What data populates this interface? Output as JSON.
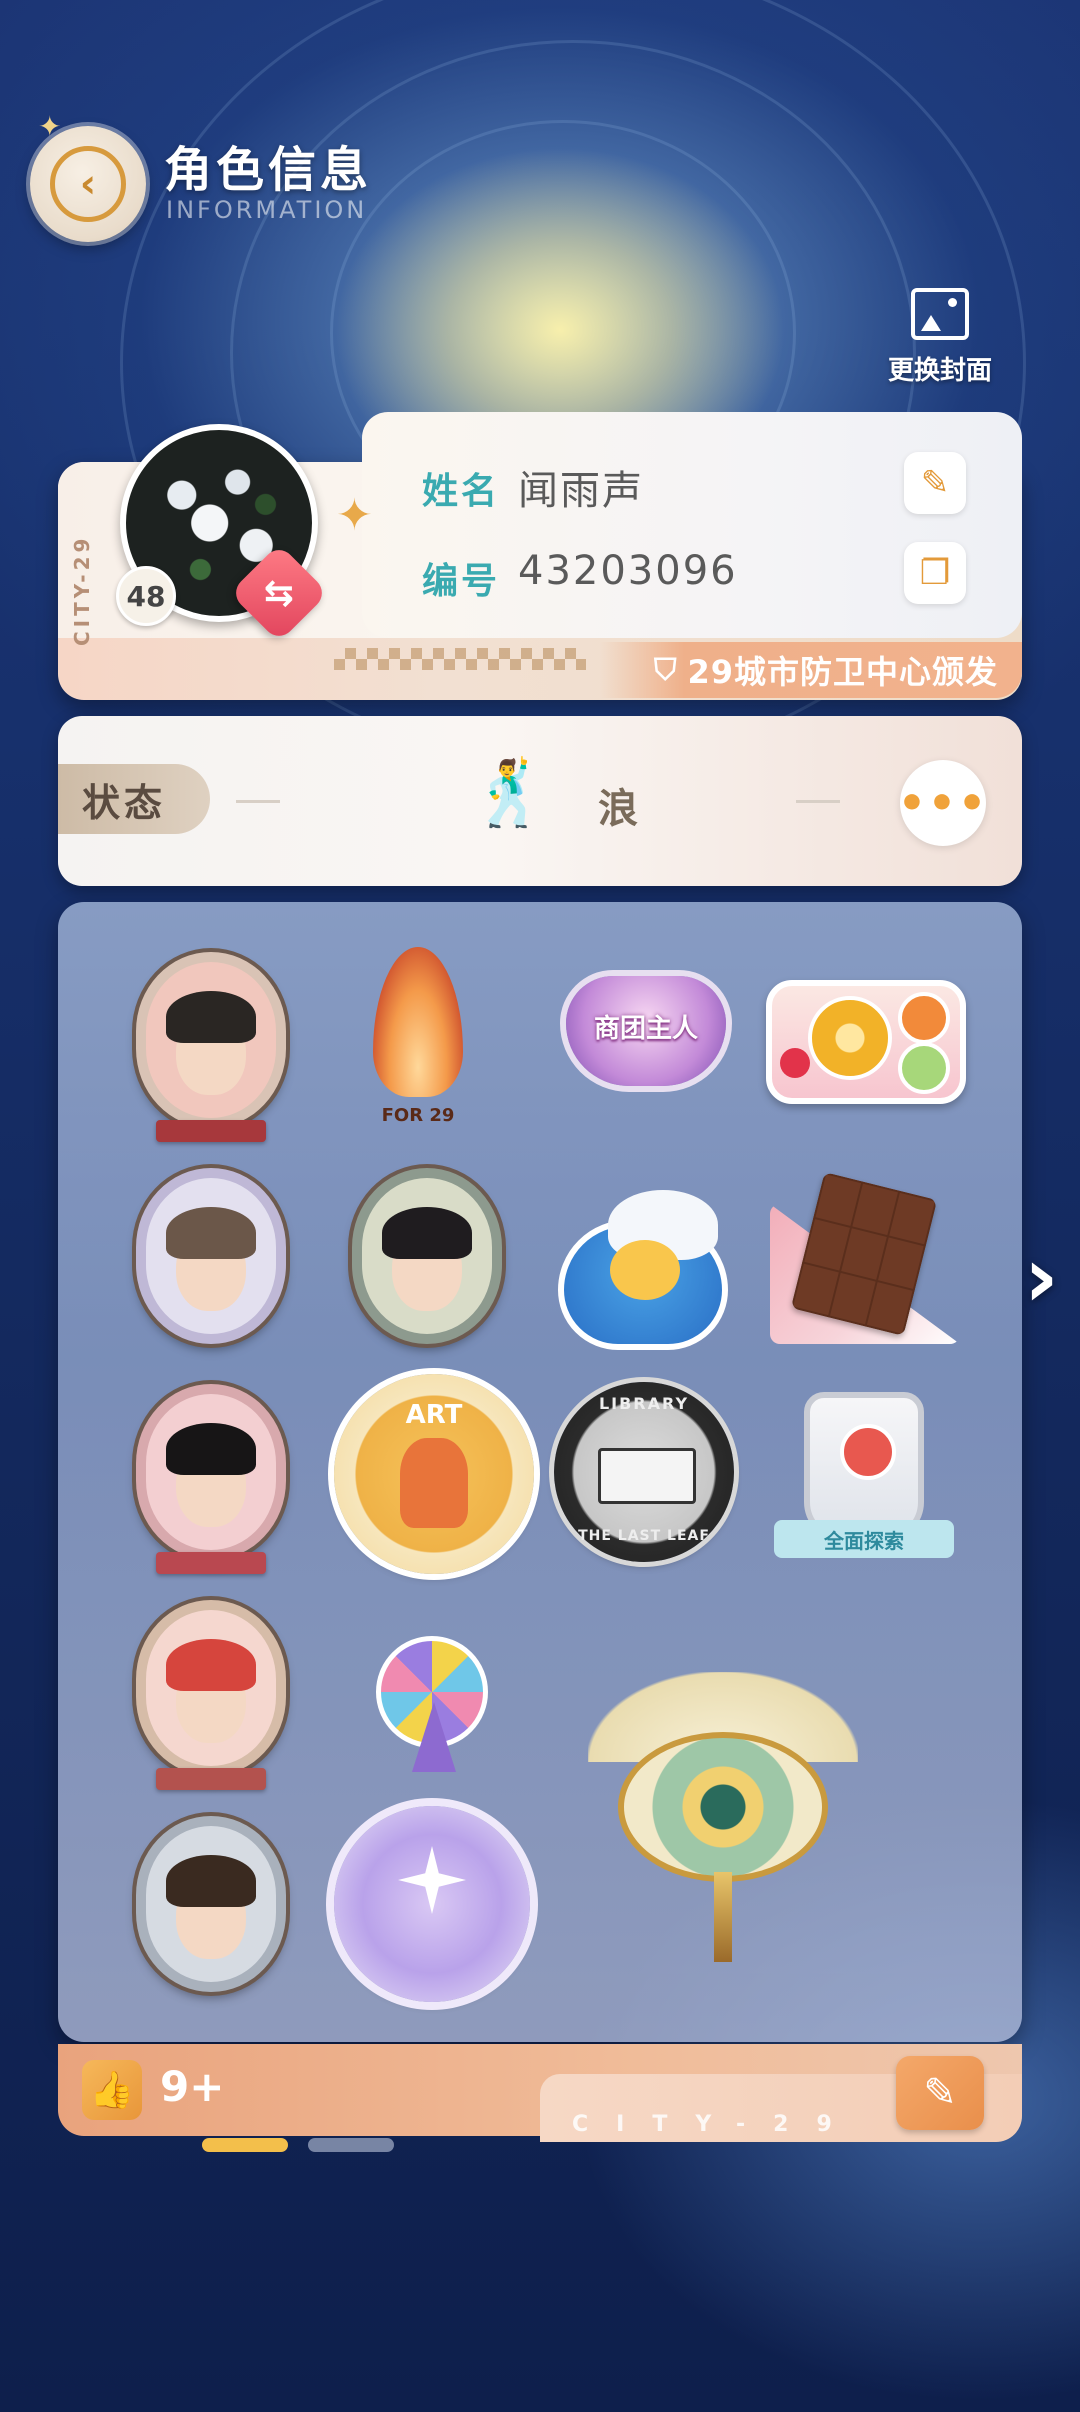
{
  "header": {
    "title": "角色信息",
    "subtitle": "INFORMATION",
    "back_icon": "chevron-left-icon",
    "change_cover_label": "更换封面",
    "change_cover_icon": "image-icon"
  },
  "profile": {
    "card_side_text": "CITY-29",
    "avatar_icon": "white-roses-avatar",
    "level": "48",
    "swap_icon": "swap-icon",
    "name_label": "姓名",
    "name_value": "闻雨声",
    "id_label": "编号",
    "id_value": "43203096",
    "edit_icon": "edit-icon",
    "copy_icon": "copy-icon",
    "issuer_text": "29城市防卫中心颁发",
    "issuer_icon": "shield-icon"
  },
  "status": {
    "label": "状态",
    "value": "浪",
    "figure_icon": "dancing-figure-icon",
    "more_icon": "more-icon"
  },
  "badges": [
    {
      "name": "portrait-badge-dark-haired-man",
      "type": "portrait"
    },
    {
      "name": "flame-badge",
      "type": "flame",
      "text": "FOR 29"
    },
    {
      "name": "guild-owner-heart-badge",
      "type": "heart",
      "text": "商团主人"
    },
    {
      "name": "fruit-badge",
      "type": "fruit"
    },
    {
      "name": "portrait-badge-glasses-woman",
      "type": "portrait"
    },
    {
      "name": "portrait-badge-dark-haired-man-2",
      "type": "portrait"
    },
    {
      "name": "rain-cat-badge",
      "type": "rain"
    },
    {
      "name": "chocolate-badge",
      "type": "chocolate"
    },
    {
      "name": "portrait-badge-girl-bows",
      "type": "portrait"
    },
    {
      "name": "art-badge",
      "type": "art",
      "text": "ART"
    },
    {
      "name": "library-badge",
      "type": "library",
      "top_text": "LIBRARY",
      "bottom_text": "THE LAST LEAF"
    },
    {
      "name": "full-explore-badge",
      "type": "explore",
      "text": "全面探索"
    },
    {
      "name": "portrait-badge-red-hair",
      "type": "portrait"
    },
    {
      "name": "ferris-wheel-badge",
      "type": "ferris"
    },
    {
      "name": "eye-emblem-badge",
      "type": "eye"
    },
    {
      "name": "portrait-badge-woman-suit",
      "type": "portrait"
    },
    {
      "name": "compass-badge",
      "type": "compass"
    }
  ],
  "footer": {
    "like_icon": "thumbs-up-icon",
    "like_count": "9+",
    "city_text": "CITY-29",
    "edit_icon": "edit-icon"
  },
  "pager": {
    "active_index": 0,
    "count": 2
  },
  "colors": {
    "accent_orange": "#e8963a",
    "label_teal": "#3aaab0",
    "swap_red": "#e1435c"
  }
}
